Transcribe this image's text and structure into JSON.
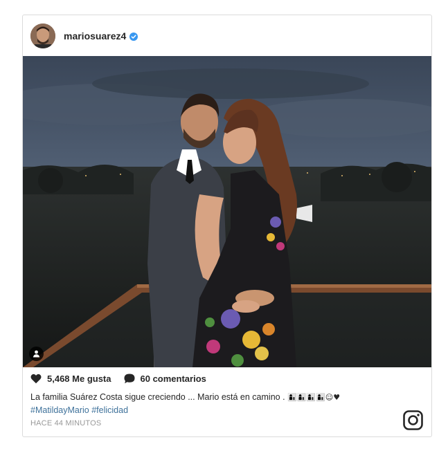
{
  "post": {
    "username": "mariosuarez4",
    "verified": true,
    "likes_label": "5,468 Me gusta",
    "comments_label": "60 comentarios",
    "caption_text": "La familia Suárez Costa sigue creciendo ... Mario está en camino . ",
    "caption_emojis": "👩‍👦👩‍👦👩‍👦👩‍👦☺♥",
    "hashtags": "#MatildayMario #felicidad",
    "timestamp": "HACE 44 MINUTOS"
  },
  "icons": {
    "avatar": "profile-avatar",
    "verified": "verified-badge-icon",
    "like": "heart-icon",
    "comment": "comment-bubble-icon",
    "user_tag": "user-tag-icon",
    "logo": "instagram-logo-icon"
  },
  "colors": {
    "verified_blue": "#3897f0",
    "hashtag_blue": "#3f729b",
    "text": "#262626",
    "muted": "#999999",
    "border": "#dbdbdb"
  }
}
